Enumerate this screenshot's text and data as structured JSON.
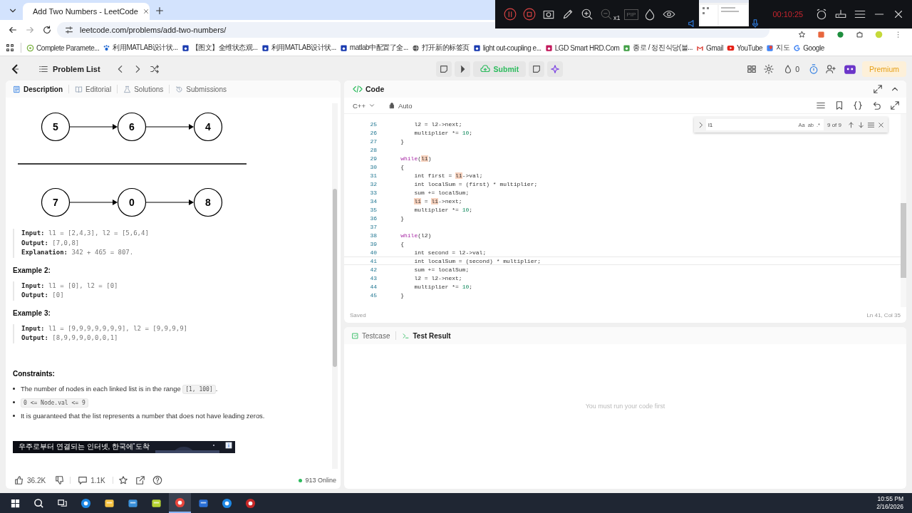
{
  "browser": {
    "tab": {
      "title": "Add Two Numbers - LeetCode"
    },
    "address": "leetcode.com/problems/add-two-numbers/",
    "bookmarks": [
      {
        "label": "Complete Paramete..."
      },
      {
        "label": "利用MATLAB设计状..."
      },
      {
        "label": "【图文】全维状态观..."
      },
      {
        "label": "利用MATLAB设计状..."
      },
      {
        "label": "matlab中配置了全..."
      },
      {
        "label": "打开新的标签页"
      },
      {
        "label": "light out-coupling e..."
      },
      {
        "label": "LGD Smart HRD.Com"
      },
      {
        "label": "종로 / 정진식당(불..."
      },
      {
        "label": "Gmail"
      },
      {
        "label": "YouTube"
      },
      {
        "label": "지도"
      },
      {
        "label": "Google"
      }
    ]
  },
  "recorder": {
    "pip": "PIP",
    "zoom": "x1",
    "timer": "00:10:25"
  },
  "header": {
    "problem_list": "Problem List",
    "submit": "Submit",
    "streak": "0",
    "premium": "Premium"
  },
  "description": {
    "tabs": [
      {
        "label": "Description",
        "selected": true
      },
      {
        "label": "Editorial",
        "selected": false
      },
      {
        "label": "Solutions",
        "selected": false
      },
      {
        "label": "Submissions",
        "selected": false
      }
    ],
    "diagram": {
      "rows": [
        [
          "5",
          "6",
          "4"
        ],
        [
          "7",
          "0",
          "8"
        ]
      ]
    },
    "examples": [
      {
        "lines": [
          {
            "label": "Input:",
            "value": "l1 = [2,4,3], l2 = [5,6,4]"
          },
          {
            "label": "Output:",
            "value": "[7,0,8]"
          },
          {
            "label": "Explanation:",
            "value": "342 + 465 = 807."
          }
        ]
      },
      {
        "heading": "Example 2:",
        "lines": [
          {
            "label": "Input:",
            "value": "l1 = [0], l2 = [0]"
          },
          {
            "label": "Output:",
            "value": "[0]"
          }
        ]
      },
      {
        "heading": "Example 3:",
        "lines": [
          {
            "label": "Input:",
            "value": "l1 = [9,9,9,9,9,9,9], l2 = [9,9,9,9]"
          },
          {
            "label": "Output:",
            "value": "[8,9,9,9,0,0,0,1]"
          }
        ]
      }
    ],
    "constraints": {
      "heading": "Constraints:",
      "items": [
        {
          "parts": [
            {
              "text": "The number of nodes in each linked list is in the range "
            },
            {
              "text": "[1, 100]",
              "code": true
            },
            {
              "text": "."
            }
          ]
        },
        {
          "parts": [
            {
              "text": "0 <= Node.val <= 9",
              "code": true
            }
          ]
        },
        {
          "parts": [
            {
              "text": "It is guaranteed that the list represents a number that does not have leading zeros."
            }
          ]
        }
      ]
    },
    "ad": {
      "headline": "우주로부터 연결되는 인터넷, 한국에 도착"
    },
    "footer": {
      "likes": "36.2K",
      "comments": "1.1K",
      "online": "913 Online"
    }
  },
  "editor": {
    "tab": "Code",
    "language": "C++",
    "mode": "Auto",
    "find": {
      "query": "l1",
      "options": [
        "Aa",
        "ab",
        ".*"
      ],
      "count": "9 of 9"
    },
    "lines": [
      {
        "number": "25",
        "current": false,
        "parts": [
          {
            "text": "        l2 = l2->next;",
            "kind": "text"
          }
        ]
      },
      {
        "number": "26",
        "current": false,
        "parts": [
          {
            "text": "        multiplier *= ",
            "kind": "text"
          },
          {
            "text": "10",
            "kind": "number"
          },
          {
            "text": ";",
            "kind": "text"
          }
        ]
      },
      {
        "number": "27",
        "current": false,
        "parts": [
          {
            "text": "    }",
            "kind": "text"
          }
        ]
      },
      {
        "number": "28",
        "current": false
      },
      {
        "number": "29",
        "current": false,
        "parts": [
          {
            "text": "    while",
            "kind": "keyword"
          },
          {
            "text": "(",
            "kind": "text"
          },
          {
            "text": "l1",
            "kind": "match"
          },
          {
            "text": ")",
            "kind": "text"
          }
        ]
      },
      {
        "number": "30",
        "current": false,
        "parts": [
          {
            "text": "    {",
            "kind": "text"
          }
        ]
      },
      {
        "number": "31",
        "current": false,
        "parts": [
          {
            "text": "        int first = ",
            "kind": "text"
          },
          {
            "text": "l1",
            "kind": "match"
          },
          {
            "text": "->val;",
            "kind": "text"
          }
        ]
      },
      {
        "number": "32",
        "current": false,
        "parts": [
          {
            "text": "        int localSum = (first) * multiplier;",
            "kind": "text"
          }
        ]
      },
      {
        "number": "33",
        "current": false,
        "parts": [
          {
            "text": "        sum += localSum;",
            "kind": "text"
          }
        ]
      },
      {
        "number": "34",
        "current": false,
        "parts": [
          {
            "text": "        l1",
            "kind": "match"
          },
          {
            "text": " = ",
            "kind": "text"
          },
          {
            "text": "l1",
            "kind": "match"
          },
          {
            "text": "->next;",
            "kind": "text"
          }
        ]
      },
      {
        "number": "35",
        "current": false,
        "parts": [
          {
            "text": "        multiplier *= ",
            "kind": "text"
          },
          {
            "text": "10",
            "kind": "number"
          },
          {
            "text": ";",
            "kind": "text"
          }
        ]
      },
      {
        "number": "36",
        "current": false,
        "parts": [
          {
            "text": "    }",
            "kind": "text"
          }
        ]
      },
      {
        "number": "37",
        "current": false
      },
      {
        "number": "38",
        "current": false,
        "parts": [
          {
            "text": "    while",
            "kind": "keyword"
          },
          {
            "text": "(l2)",
            "kind": "text"
          }
        ]
      },
      {
        "number": "39",
        "current": false,
        "parts": [
          {
            "text": "    {",
            "kind": "text"
          }
        ]
      },
      {
        "number": "40",
        "current": false,
        "parts": [
          {
            "text": "        int second = l2->val;",
            "kind": "text"
          }
        ]
      },
      {
        "number": "41",
        "current": true,
        "parts": [
          {
            "text": "        int localSum = (second) * multiplier;",
            "kind": "text"
          }
        ]
      },
      {
        "number": "42",
        "current": false,
        "parts": [
          {
            "text": "        sum += localSum;",
            "kind": "text"
          }
        ]
      },
      {
        "number": "43",
        "current": false,
        "parts": [
          {
            "text": "        l2 = l2->next;",
            "kind": "text"
          }
        ]
      },
      {
        "number": "44",
        "current": false,
        "parts": [
          {
            "text": "        multiplier *= ",
            "kind": "text"
          },
          {
            "text": "10",
            "kind": "number"
          },
          {
            "text": ";",
            "kind": "text"
          }
        ]
      },
      {
        "number": "45",
        "current": false,
        "parts": [
          {
            "text": "    }",
            "kind": "text"
          }
        ]
      }
    ],
    "status": "Saved",
    "position": "Ln 41, Col 35"
  },
  "results": {
    "tabs": [
      {
        "label": "Testcase",
        "selected": false
      },
      {
        "label": "Test Result",
        "selected": true
      }
    ],
    "message": "You must run your code first"
  },
  "taskbar": {
    "time": "10:55 PM",
    "date": "2/16/2026"
  }
}
